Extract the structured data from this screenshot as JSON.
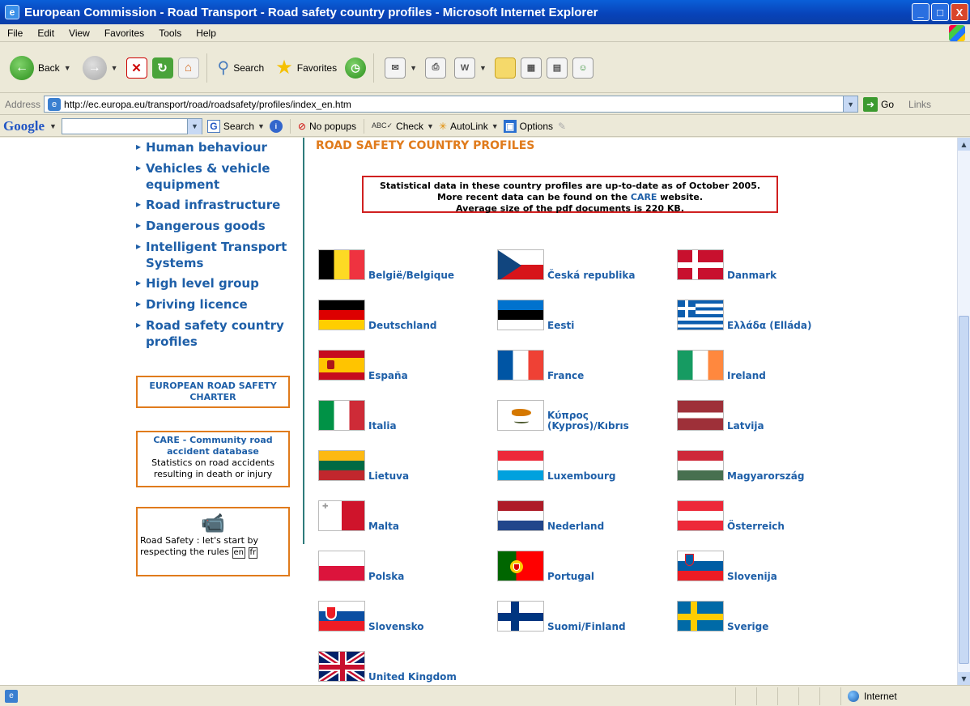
{
  "window": {
    "title": "European Commission - Road Transport - Road safety country profiles - Microsoft Internet Explorer",
    "minimize": "_",
    "maximize": "□",
    "close": "X"
  },
  "menu": [
    "File",
    "Edit",
    "View",
    "Favorites",
    "Tools",
    "Help"
  ],
  "toolbar": {
    "back_label": "Back",
    "search_label": "Search",
    "favorites_label": "Favorites"
  },
  "address": {
    "label": "Address",
    "url": "http://ec.europa.eu/transport/road/roadsafety/profiles/index_en.htm",
    "go_label": "Go",
    "links_label": "Links"
  },
  "googlebar": {
    "logo": "Google",
    "search_label": "Search",
    "nopopups_label": "No popups",
    "check_label": "Check",
    "autolink_label": "AutoLink",
    "options_label": "Options"
  },
  "leftnav": {
    "items": [
      "Human behaviour",
      "Vehicles & vehicle equipment",
      "Road infrastructure",
      "Dangerous goods",
      "Intelligent Transport Systems",
      "High level group",
      "Driving licence",
      "Road safety country profiles"
    ],
    "charter_label": "EUROPEAN ROAD SAFETY CHARTER",
    "care_title": "CARE - Community road accident database",
    "care_desc": "Statistics on road accidents resulting in death or injury",
    "campaign_text": "Road Safety : let's start by respecting the rules",
    "lang_en": "en",
    "lang_fr": "fr"
  },
  "main": {
    "heading": "ROAD SAFETY COUNTRY PROFILES",
    "notice_line1": "Statistical data in these country profiles are up-to-date as of October 2005.",
    "notice_line2_pre": "More recent data can be found on the ",
    "notice_care": "CARE",
    "notice_line2_post": " website.",
    "notice_line3": "Average size of the pdf documents is 220 KB."
  },
  "countries": [
    "België/Belgique",
    "Česká republika",
    "Danmark",
    "Deutschland",
    "Eesti",
    "Ελλάδα (Elláda)",
    "España",
    "France",
    "Ireland",
    "Italia",
    "Κύπρος (Kypros)/Kıbrıs",
    "Latvija",
    "Lietuva",
    "Luxembourg",
    "Magyarország",
    "Malta",
    "Nederland",
    "Österreich",
    "Polska",
    "Portugal",
    "Slovenija",
    "Slovensko",
    "Suomi/Finland",
    "Sverige",
    "United Kingdom"
  ],
  "status": {
    "zone": "Internet"
  }
}
